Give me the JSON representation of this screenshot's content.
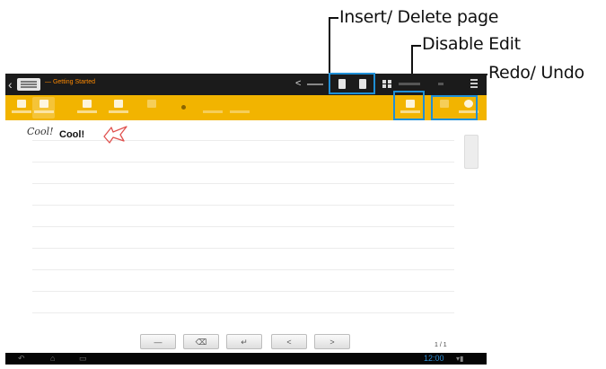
{
  "callouts": {
    "insert_delete": "Insert/ Delete page",
    "disable_edit": "Disable Edit",
    "redo_undo": "Redo/ Undo"
  },
  "screen": {
    "actionbar": {
      "back_icon": "chevron-left-icon",
      "app_icon": "notebook-icon",
      "title": "— Getting Started",
      "share_icon": "share-icon",
      "insert_page_icon": "insert-page-icon",
      "delete_page_icon": "delete-page-icon",
      "grid_icon": "grid-icon",
      "menu_icon": "overflow-menu-icon"
    },
    "toolbar": {
      "selected_tool": "handwriting",
      "tools": [
        "hand-tool-icon",
        "handwriting-icon",
        "keyboard-icon",
        "insert-icon",
        "dim-tool-icon",
        "brush-dot-icon",
        "color-icon",
        "more-icon"
      ],
      "disable_edit_icon": "disable-edit-icon",
      "undo_icon": "undo-icon",
      "redo_icon": "redo-icon"
    },
    "page": {
      "handwriting": "Cool!",
      "typed_text": "Cool!",
      "stroke_color": "#e0524f"
    },
    "keys": {
      "space": "—",
      "backspace": "⌫",
      "enter": "↵",
      "left": "<",
      "right": ">"
    },
    "page_indicator": "1 / 1",
    "navbar": {
      "back": "↶",
      "home": "⌂",
      "recent": "▭",
      "clock": "12:00",
      "status": "▾▮"
    }
  },
  "colors": {
    "accent": "#f2b400",
    "highlight": "#1f8fd6",
    "actionbar": "#1b1b1b"
  }
}
